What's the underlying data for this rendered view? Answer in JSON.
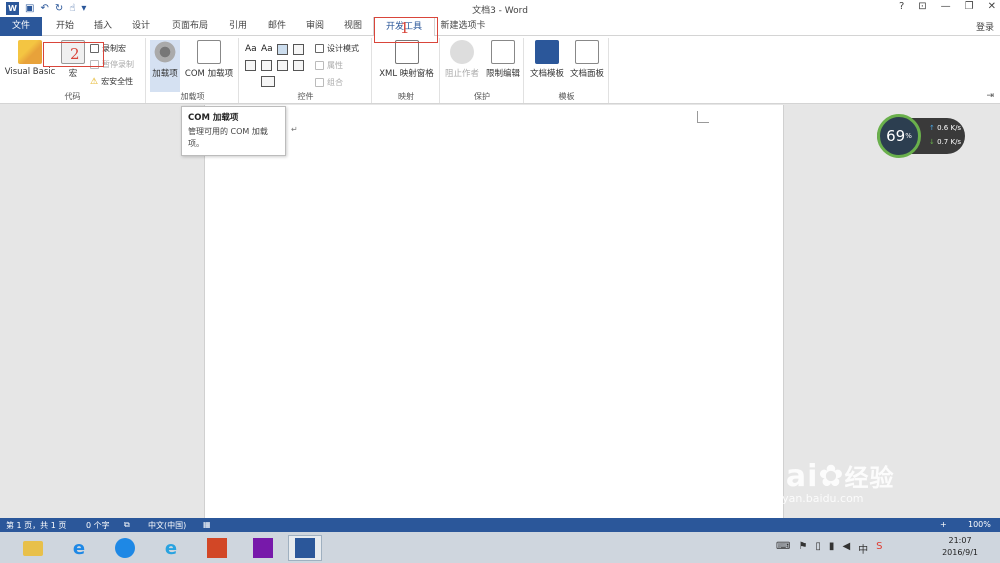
{
  "window": {
    "title": "文档3 - Word",
    "controls": [
      "?",
      "⊡",
      "—",
      "❐",
      "✕"
    ]
  },
  "tabs": [
    {
      "label": "文件"
    },
    {
      "label": "开始"
    },
    {
      "label": "插入"
    },
    {
      "label": "设计"
    },
    {
      "label": "页面布局"
    },
    {
      "label": "引用"
    },
    {
      "label": "邮件"
    },
    {
      "label": "审阅"
    },
    {
      "label": "视图"
    },
    {
      "label": "开发工具"
    },
    {
      "label": "新建选项卡"
    }
  ],
  "login_label": "登录",
  "ribbon": {
    "code": {
      "label": "代码",
      "visual_basic": "Visual Basic",
      "macro": "宏",
      "record_macro": "录制宏",
      "pause_recording": "暂停录制",
      "macro_security": "宏安全性"
    },
    "addins": {
      "label": "加载项",
      "addins_btn": "加载项",
      "com_addins_btn": "COM 加载项"
    },
    "controls": {
      "label": "控件",
      "design_mode": "设计模式",
      "properties": "属性",
      "group": "组合"
    },
    "mapping": {
      "label": "映射",
      "xml_pane": "XML 映射窗格"
    },
    "protect": {
      "label": "保护",
      "block_authors": "阻止作者",
      "restrict_editing": "限制编辑"
    },
    "templates": {
      "label": "模板",
      "doc_template": "文档模板",
      "doc_panel": "文档面板"
    }
  },
  "annotations": {
    "one": "1",
    "two": "2"
  },
  "tooltip": {
    "title": "COM 加载项",
    "desc": "管理可用的 COM 加载项。"
  },
  "speed_widget": {
    "percent": "69",
    "percent_unit": "%",
    "up": "0.6",
    "down": "0.7",
    "unit": "K/s"
  },
  "statusbar": {
    "page": "第 1 页，共 1 页",
    "words": "0 个字",
    "language": "中文(中国)",
    "zoom": "100%"
  },
  "taskbar": {
    "time": "21:07",
    "date": "2016/9/1"
  },
  "watermark": {
    "brand": "Bai",
    "brand_cn": "经验",
    "url": "jingyan.baidu.com"
  },
  "colors": {
    "accent": "#2b579a",
    "annotation": "#d9453a"
  }
}
